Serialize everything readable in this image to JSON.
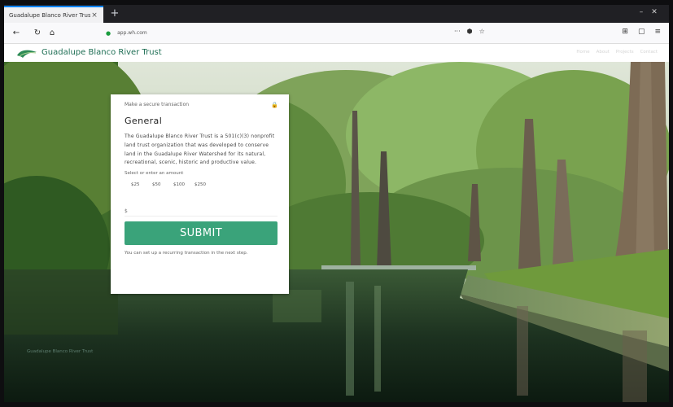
{
  "browser": {
    "tab_title": "Guadalupe Blanco River Trust",
    "tab_close": "×",
    "new_tab": "+",
    "url": "app.wh.com",
    "right_icons": [
      "⊞",
      "▢",
      "≡"
    ]
  },
  "site": {
    "title": "Guadalupe Blanco River Trust",
    "nav": [
      "Home",
      "About",
      "Projects",
      "Contact"
    ]
  },
  "card": {
    "subtitle": "Make a secure transaction",
    "heading": "General",
    "description": "The Guadalupe Blanco River Trust is a 501(c)(3) nonprofit land trust organization that was developed to conserve land in the Guadalupe River Watershed for its natural, recreational, scenic, historic and productive value.",
    "amount_label": "Select or enter an amount",
    "amounts": [
      "$25",
      "$50",
      "$100",
      "$250"
    ],
    "custom_placeholder": "$",
    "submit_label": "SUBMIT",
    "footnote": "You can set up a recurring transaction in the next step."
  },
  "footer": {
    "link": "Guadalupe Blanco River Trust"
  },
  "icons": [
    "back-arrow-icon",
    "reload-icon",
    "home-icon",
    "lock-icon",
    "shield-icon",
    "star-icon",
    "close-icon",
    "logo-icon"
  ]
}
